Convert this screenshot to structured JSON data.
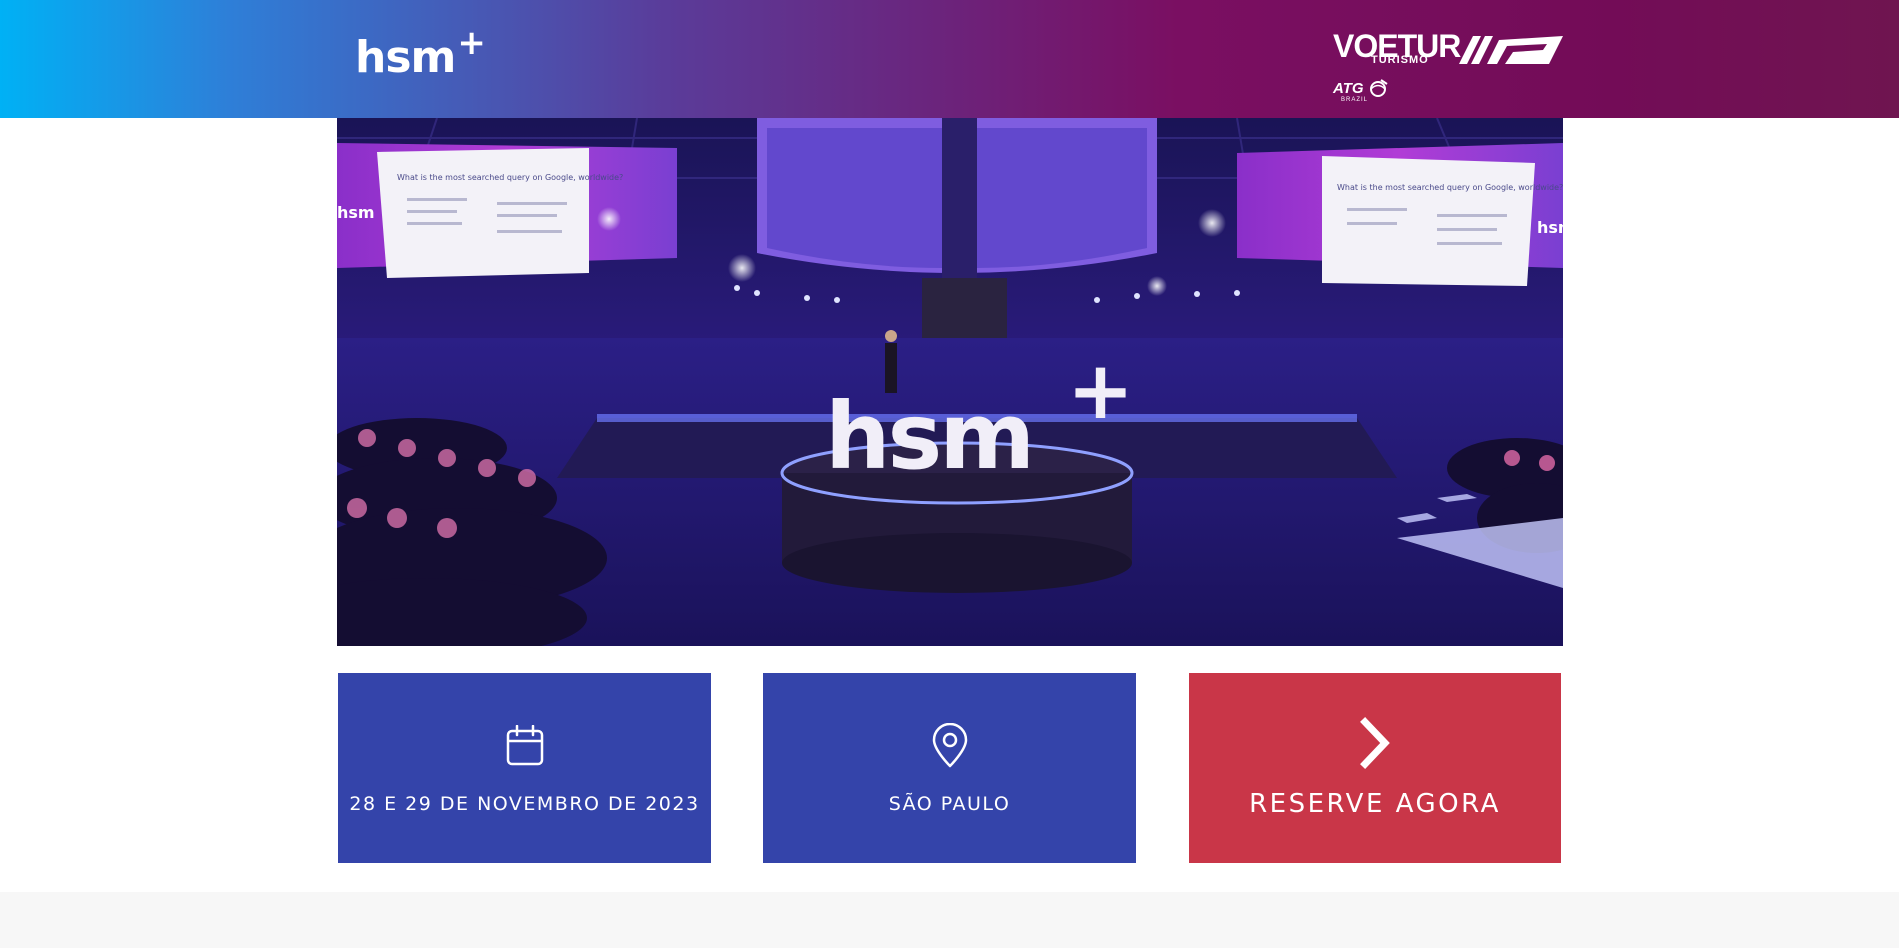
{
  "header": {
    "logo_text": "hsm",
    "logo_mark": "+",
    "partner": {
      "name": "VOETUR",
      "subtitle": "TURISMO",
      "secondary_name": "ATG",
      "secondary_subtitle": "BRAZIL"
    }
  },
  "hero": {
    "stage_sign": "hsm",
    "stage_sign_mark": "+",
    "screen_text": "What is the most searched query on Google, worldwide?",
    "side_wall_text": "hsm"
  },
  "cards": {
    "date": {
      "icon": "calendar-icon",
      "label": "28 E 29 DE NOVEMBRO DE 2023"
    },
    "location": {
      "icon": "map-pin-icon",
      "label": "SÃO PAULO"
    },
    "cta": {
      "icon": "chevron-right-icon",
      "label": "RESERVE AGORA"
    }
  },
  "colors": {
    "header_gradient_start": "#00b1f5",
    "header_gradient_end": "#6f1550",
    "card_blue": "#3444aa",
    "card_red": "#c93648",
    "footer_bg": "#f7f7f7"
  }
}
